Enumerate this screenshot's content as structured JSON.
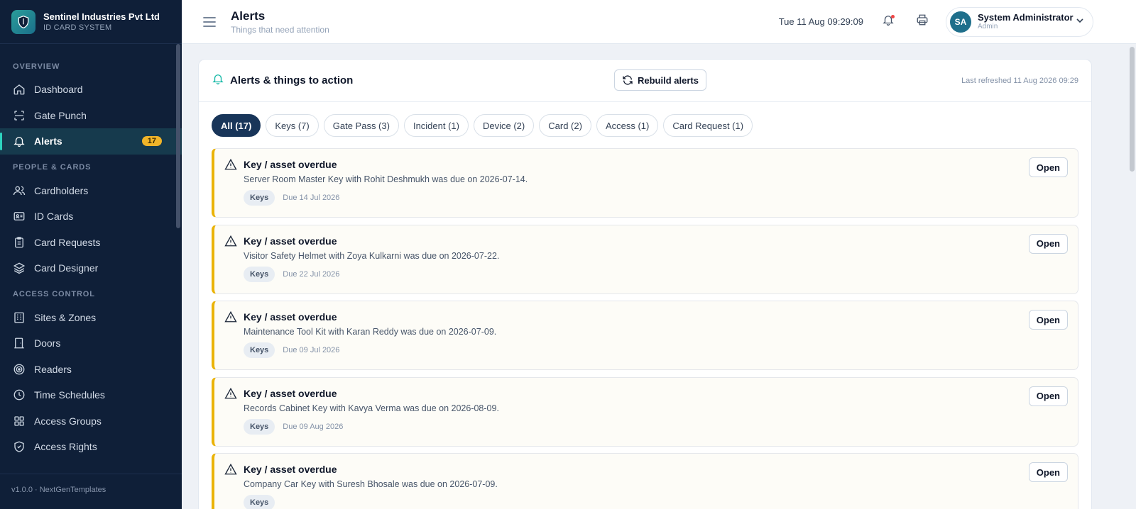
{
  "brand": {
    "name": "Sentinel Industries Pvt Ltd",
    "subtitle": "ID CARD SYSTEM"
  },
  "sidebar": {
    "sections": [
      {
        "title": "OVERVIEW",
        "items": [
          {
            "label": "Dashboard",
            "icon": "home-icon"
          },
          {
            "label": "Gate Punch",
            "icon": "scan-icon"
          },
          {
            "label": "Alerts",
            "icon": "bell-icon",
            "active": true,
            "badge": "17"
          }
        ]
      },
      {
        "title": "PEOPLE & CARDS",
        "items": [
          {
            "label": "Cardholders",
            "icon": "users-icon"
          },
          {
            "label": "ID Cards",
            "icon": "id-card-icon"
          },
          {
            "label": "Card Requests",
            "icon": "clipboard-icon"
          },
          {
            "label": "Card Designer",
            "icon": "layers-icon"
          }
        ]
      },
      {
        "title": "ACCESS CONTROL",
        "items": [
          {
            "label": "Sites & Zones",
            "icon": "building-icon"
          },
          {
            "label": "Doors",
            "icon": "door-icon"
          },
          {
            "label": "Readers",
            "icon": "target-icon"
          },
          {
            "label": "Time Schedules",
            "icon": "clock-icon"
          },
          {
            "label": "Access Groups",
            "icon": "grid-icon"
          },
          {
            "label": "Access Rights",
            "icon": "shield-icon"
          }
        ]
      }
    ],
    "footer": "v1.0.0 · NextGenTemplates"
  },
  "header": {
    "title": "Alerts",
    "subtitle": "Things that need attention",
    "datetime": "Tue 11 Aug 09:29:09",
    "user": {
      "initials": "SA",
      "name": "System Administrator",
      "role": "Admin"
    }
  },
  "panel": {
    "title": "Alerts & things to action",
    "rebuild_label": "Rebuild alerts",
    "last_refreshed": "Last refreshed 11 Aug 2026 09:29",
    "filters": [
      {
        "label": "All (17)",
        "active": true
      },
      {
        "label": "Keys (7)"
      },
      {
        "label": "Gate Pass (3)"
      },
      {
        "label": "Incident (1)"
      },
      {
        "label": "Device (2)"
      },
      {
        "label": "Card (2)"
      },
      {
        "label": "Access (1)"
      },
      {
        "label": "Card Request (1)"
      }
    ],
    "open_label": "Open",
    "alerts": [
      {
        "title": "Key / asset overdue",
        "message": "Server Room Master Key with Rohit Deshmukh was due on 2026-07-14.",
        "tag": "Keys",
        "due": "Due 14 Jul 2026"
      },
      {
        "title": "Key / asset overdue",
        "message": "Visitor Safety Helmet with Zoya Kulkarni was due on 2026-07-22.",
        "tag": "Keys",
        "due": "Due 22 Jul 2026"
      },
      {
        "title": "Key / asset overdue",
        "message": "Maintenance Tool Kit with Karan Reddy was due on 2026-07-09.",
        "tag": "Keys",
        "due": "Due 09 Jul 2026"
      },
      {
        "title": "Key / asset overdue",
        "message": "Records Cabinet Key with Kavya Verma was due on 2026-08-09.",
        "tag": "Keys",
        "due": "Due 09 Aug 2026"
      },
      {
        "title": "Key / asset overdue",
        "message": "Company Car Key with Suresh Bhosale was due on 2026-07-09.",
        "tag": "Keys",
        "due": ""
      }
    ]
  },
  "colors": {
    "sidebar_bg": "#0f1f38",
    "accent": "#2dd4bf",
    "badge": "#f0b429",
    "alert_border": "#eab308",
    "chip_active": "#183559"
  }
}
